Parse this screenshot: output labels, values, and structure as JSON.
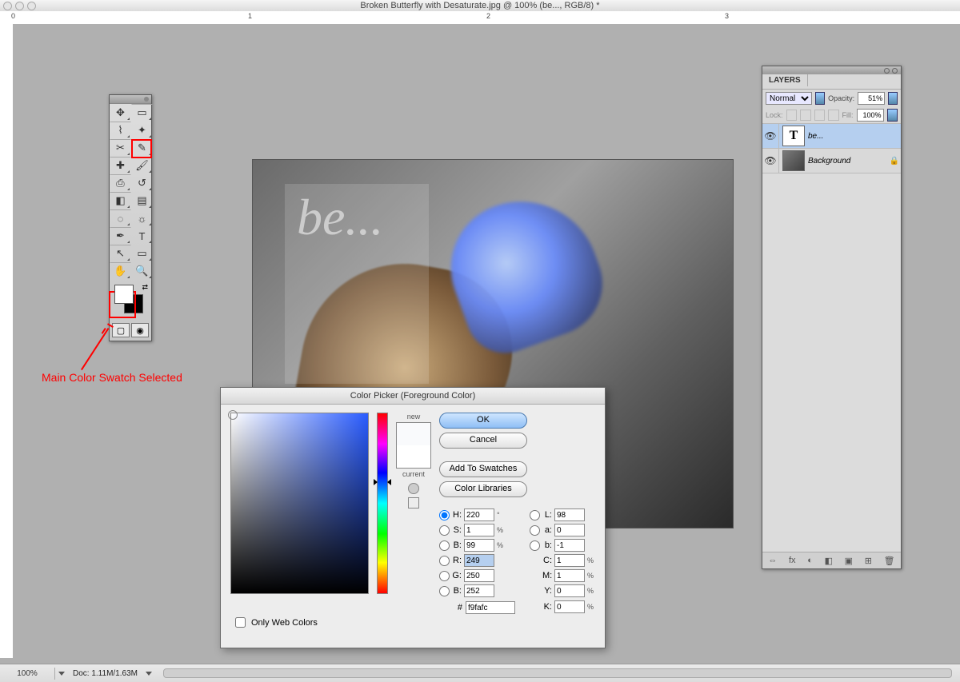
{
  "window": {
    "title": "Broken Butterfly with Desaturate.jpg @ 100% (be..., RGB/8) *"
  },
  "annotation": {
    "text": "Main Color Swatch Selected"
  },
  "ruler_labels": [
    "0",
    "1",
    "2",
    "3"
  ],
  "toolbox": {
    "tools": [
      {
        "n": "move",
        "g": "✥"
      },
      {
        "n": "marquee",
        "g": "▭"
      },
      {
        "n": "lasso",
        "g": "⌇"
      },
      {
        "n": "magic-wand",
        "g": "✦"
      },
      {
        "n": "crop",
        "g": "✂"
      },
      {
        "n": "eyedropper",
        "g": "✎"
      },
      {
        "n": "healing",
        "g": "✚"
      },
      {
        "n": "brush",
        "g": "🖌"
      },
      {
        "n": "stamp",
        "g": "⎙"
      },
      {
        "n": "history-brush",
        "g": "↺"
      },
      {
        "n": "eraser",
        "g": "◧"
      },
      {
        "n": "gradient",
        "g": "▤"
      },
      {
        "n": "blur",
        "g": "◌"
      },
      {
        "n": "dodge",
        "g": "☼"
      },
      {
        "n": "pen",
        "g": "✒"
      },
      {
        "n": "type",
        "g": "T"
      },
      {
        "n": "path-select",
        "g": "↖"
      },
      {
        "n": "shape",
        "g": "▭"
      },
      {
        "n": "hand",
        "g": "✋"
      },
      {
        "n": "zoom",
        "g": "🔍"
      }
    ]
  },
  "layers_panel": {
    "tab": "LAYERS",
    "blend_mode": "Normal",
    "opacity_label": "Opacity:",
    "opacity_value": "51%",
    "lock_label": "Lock:",
    "fill_label": "Fill:",
    "fill_value": "100%",
    "rows": [
      {
        "name": "be...",
        "thumb": "T",
        "italic": true
      },
      {
        "name": "Background",
        "thumb": "img",
        "italic": true,
        "locked": true
      }
    ],
    "footer_icons": [
      "⇔",
      "fx",
      "◐",
      "◧",
      "▣",
      "⊞",
      "🗑"
    ]
  },
  "color_picker": {
    "title": "Color Picker (Foreground Color)",
    "new_label": "new",
    "current_label": "current",
    "ok": "OK",
    "cancel": "Cancel",
    "add": "Add To Swatches",
    "libraries": "Color Libraries",
    "hsb": {
      "H": "220",
      "S": "1",
      "B": "99"
    },
    "lab": {
      "L": "98",
      "a": "0",
      "b": "-1"
    },
    "rgb": {
      "R": "249",
      "G": "250",
      "B": "252"
    },
    "cmyk": {
      "C": "1",
      "M": "1",
      "Y": "0",
      "K": "0"
    },
    "hex": "f9fafc",
    "only_web": "Only Web Colors",
    "units": {
      "deg": "°",
      "pct": "%"
    },
    "labels": {
      "H": "H:",
      "S": "S:",
      "Bb": "B:",
      "L": "L:",
      "a": "a:",
      "b": "b:",
      "R": "R:",
      "G": "G:",
      "Bl": "B:",
      "C": "C:",
      "M": "M:",
      "Y": "Y:",
      "K": "K:",
      "hash": "#"
    }
  },
  "status": {
    "zoom": "100%",
    "doc_label": "Doc:",
    "doc_size": "1.11M/1.63M"
  },
  "doc_text": "be..."
}
